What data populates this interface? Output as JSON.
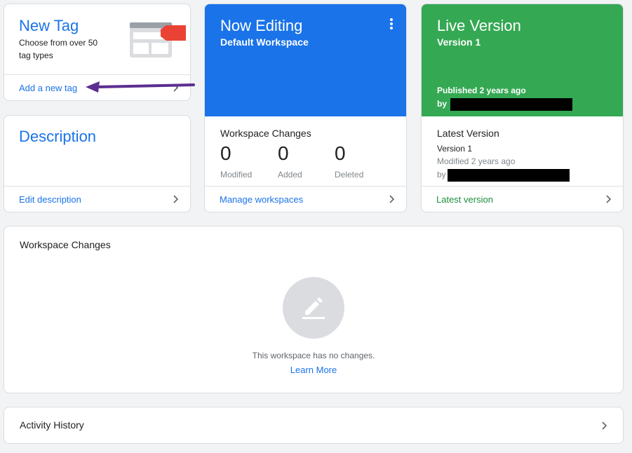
{
  "colors": {
    "accent_blue": "#1a73e8",
    "live_green": "#34a853",
    "link_green": "#1e8e3e",
    "annotation_purple": "#5c2d91"
  },
  "new_tag": {
    "title": "New Tag",
    "subtitle": "Choose from over 50 tag types",
    "link": "Add a new tag",
    "icon": "tag-illustration-icon"
  },
  "description": {
    "title": "Description",
    "link": "Edit description"
  },
  "now_editing": {
    "title": "Now Editing",
    "workspace": "Default Workspace",
    "changes_label": "Workspace Changes",
    "stats": [
      {
        "value": "0",
        "label": "Modified"
      },
      {
        "value": "0",
        "label": "Added"
      },
      {
        "value": "0",
        "label": "Deleted"
      }
    ],
    "link": "Manage workspaces"
  },
  "live_version": {
    "title": "Live Version",
    "version": "Version 1",
    "published": "Published 2 years ago",
    "by_label": "by",
    "latest_title": "Latest Version",
    "latest_version": "Version 1",
    "latest_modified": "Modified 2 years ago",
    "latest_by_label": "by",
    "link": "Latest version"
  },
  "workspace_changes": {
    "title": "Workspace Changes",
    "empty_text": "This workspace has no changes.",
    "learn_more": "Learn More"
  },
  "activity_history": {
    "title": "Activity History"
  }
}
